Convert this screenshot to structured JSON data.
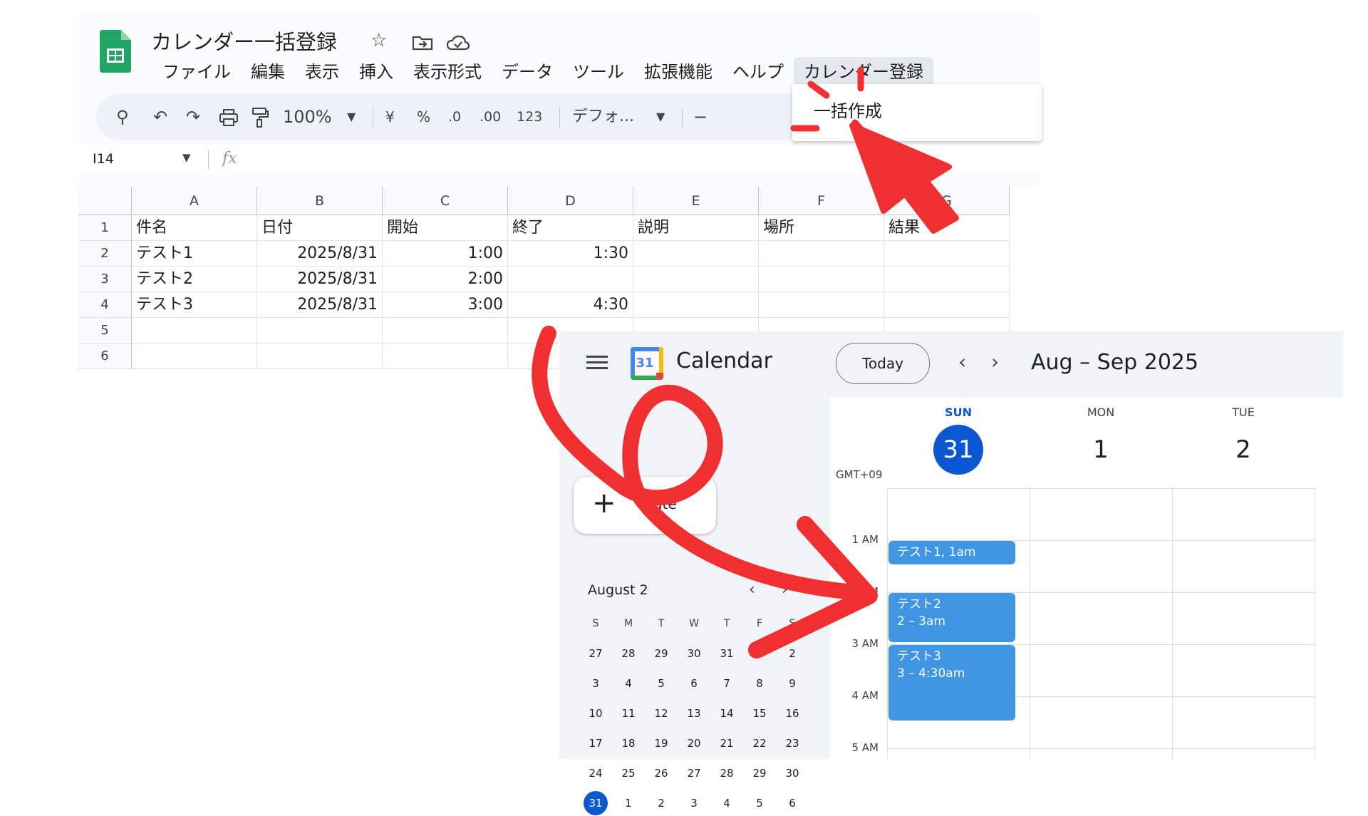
{
  "sheets": {
    "title": "カレンダー一括登録",
    "menu": [
      "ファイル",
      "編集",
      "表示",
      "挿入",
      "表示形式",
      "データ",
      "ツール",
      "拡張機能",
      "ヘルプ",
      "カレンダー登録"
    ],
    "toolbar": {
      "zoom": "100%",
      "currency": "¥",
      "percent": "%",
      "dec_decrease": ".0",
      "dec_increase": ".00",
      "number_format": "123",
      "font": "デフォ...",
      "minus": "−"
    },
    "name_box": "I14",
    "fx": "fx",
    "dropdown_item": "一括作成",
    "columns": [
      "A",
      "B",
      "C",
      "D",
      "E",
      "F",
      "G"
    ],
    "row_numbers": [
      "1",
      "2",
      "3",
      "4",
      "5",
      "6"
    ],
    "rows": [
      [
        "件名",
        "日付",
        "開始",
        "終了",
        "説明",
        "場所",
        "結果"
      ],
      [
        "テスト1",
        "2025/8/31",
        "1:00",
        "1:30",
        "",
        "",
        ""
      ],
      [
        "テスト2",
        "2025/8/31",
        "2:00",
        "",
        "",
        "",
        ""
      ],
      [
        "テスト3",
        "2025/8/31",
        "3:00",
        "4:30",
        "",
        "",
        ""
      ],
      [
        "",
        "",
        "",
        "",
        "",
        "",
        ""
      ],
      [
        "",
        "",
        "",
        "",
        "",
        "",
        ""
      ]
    ]
  },
  "calendar": {
    "app_name": "Calendar",
    "logo_day": "31",
    "today_label": "Today",
    "date_range": "Aug – Sep 2025",
    "create_plus": "+",
    "create_label": "eate",
    "mini": {
      "month": "August 2",
      "dow": [
        "S",
        "M",
        "T",
        "W",
        "T",
        "F",
        "S"
      ],
      "weeks": [
        [
          "27",
          "28",
          "29",
          "30",
          "31",
          "1",
          "2"
        ],
        [
          "3",
          "4",
          "5",
          "6",
          "7",
          "8",
          "9"
        ],
        [
          "10",
          "11",
          "12",
          "13",
          "14",
          "15",
          "16"
        ],
        [
          "17",
          "18",
          "19",
          "20",
          "21",
          "22",
          "23"
        ],
        [
          "24",
          "25",
          "26",
          "27",
          "28",
          "29",
          "30"
        ],
        [
          "31",
          "1",
          "2",
          "3",
          "4",
          "5",
          "6"
        ]
      ],
      "selected": "31"
    },
    "days": [
      {
        "dow": "SUN",
        "num": "31",
        "today": true
      },
      {
        "dow": "MON",
        "num": "1",
        "today": false
      },
      {
        "dow": "TUE",
        "num": "2",
        "today": false
      }
    ],
    "timezone": "GMT+09",
    "hours": [
      "1 AM",
      "2 AM",
      "3 AM",
      "4 AM",
      "5 AM"
    ],
    "events": [
      {
        "title": "テスト1, 1am",
        "time": ""
      },
      {
        "title": "テスト2",
        "time": "2 – 3am"
      },
      {
        "title": "テスト3",
        "time": "3 – 4:30am"
      }
    ]
  },
  "colors": {
    "accent_blue": "#0b57d0",
    "event_blue": "#4196e4",
    "annotation_red": "#f03030",
    "sheets_green": "#23a566"
  }
}
